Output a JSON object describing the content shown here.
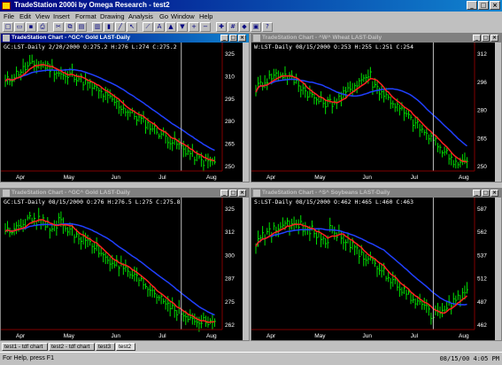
{
  "app": {
    "title": "TradeStation 2000i by Omega Research - test2"
  },
  "menu": [
    "File",
    "Edit",
    "View",
    "Insert",
    "Format",
    "Drawing",
    "Analysis",
    "Go",
    "Window",
    "Help"
  ],
  "toolbar": [
    "new-doc-icon",
    "open-icon",
    "save-icon",
    "print-icon",
    "cut-icon",
    "copy-icon",
    "paste-icon",
    "chart-icon",
    "bar-icon",
    "line-icon",
    "cursor-icon",
    "trendline-icon",
    "text-icon",
    "arrow-up-icon",
    "arrow-down-icon",
    "zoom-in-icon",
    "zoom-out-icon",
    "crosshair-icon",
    "grid-icon",
    "expert-icon",
    "window-icon",
    "help-icon"
  ],
  "charts": [
    {
      "id": "top-left",
      "title": "TradeStation Chart - ^GC^ Gold LAST-Daily",
      "info": "GC:LST-Daily  2/20/2000  O:275.2  H:276  L:274  C:275.2",
      "active": true,
      "ylabels": [
        "325",
        "310",
        "295",
        "280",
        "265",
        "250"
      ],
      "xlabels": [
        "Apr",
        "May",
        "Jun",
        "Jul",
        "Aug"
      ]
    },
    {
      "id": "top-right",
      "title": "TradeStation Chart - ^W^ Wheat LAST-Daily",
      "info": "W:LST-Daily  08/15/2000  O:253  H:255  L:251  C:254",
      "active": false,
      "ylabels": [
        "312",
        "296",
        "280",
        "265",
        "250"
      ],
      "xlabels": [
        "Apr",
        "May",
        "Jun",
        "Jul",
        "Aug"
      ]
    },
    {
      "id": "bottom-left",
      "title": "TradeStation Chart - ^GC^ Gold LAST-Daily",
      "info": "GC:LST-Daily  08/15/2000  O:276  H:276.5  L:275  C:275.8",
      "active": false,
      "ylabels": [
        "325",
        "312",
        "300",
        "287",
        "275",
        "262"
      ],
      "xlabels": [
        "Apr",
        "May",
        "Jun",
        "Jul",
        "Aug"
      ]
    },
    {
      "id": "bottom-right",
      "title": "TradeStation Chart - ^S^ Soybeans LAST-Daily",
      "info": "S:LST-Daily  08/15/2000  O:462  H:465  L:460  C:463",
      "active": false,
      "ylabels": [
        "587",
        "562",
        "537",
        "512",
        "487",
        "462"
      ],
      "xlabels": [
        "Apr",
        "May",
        "Jun",
        "Jul",
        "Aug"
      ]
    }
  ],
  "tabs": [
    "test1 - tdf chart",
    "test2 - tdf chart",
    "test3",
    "test2"
  ],
  "status": {
    "message": "For Help, press F1",
    "clock": "08/15/00  4:05 PM"
  },
  "colors": {
    "bars": "#00e000",
    "ma_fast": "#ff2020",
    "ma_slow": "#2040ff",
    "background": "#000000",
    "cursor": "#c0c0c0"
  }
}
